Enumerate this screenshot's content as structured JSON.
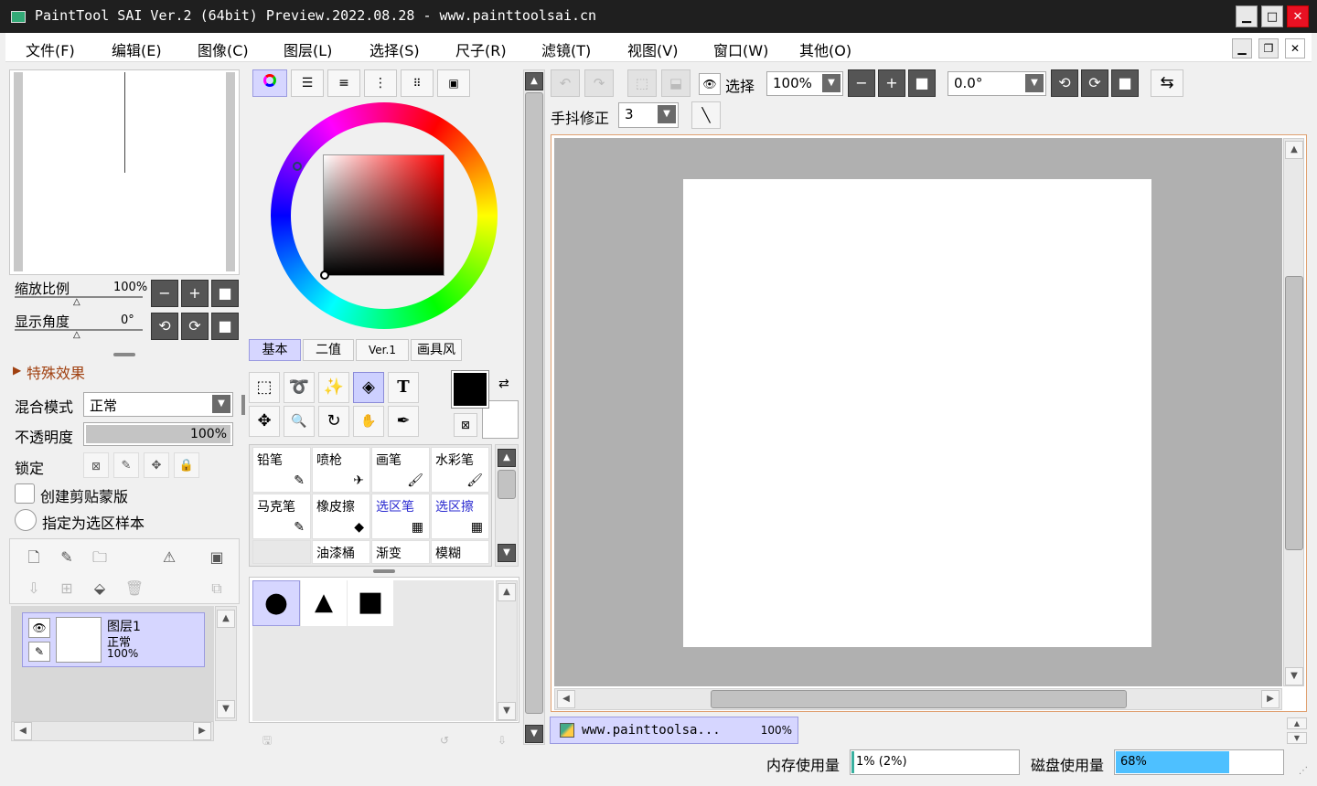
{
  "window": {
    "title": "PaintTool SAI Ver.2 (64bit) Preview.2022.08.28 - www.painttoolsai.cn",
    "minimize": "▁",
    "maximize": "□",
    "close": "✕"
  },
  "menu": [
    "文件(F)",
    "编辑(E)",
    "图像(C)",
    "图层(L)",
    "选择(S)",
    "尺子(R)",
    "滤镜(T)",
    "视图(V)",
    "窗口(W)",
    "其他(O)"
  ],
  "mdi": {
    "minimize": "▁",
    "restore": "❐",
    "close": "✕"
  },
  "navigator": {
    "zoom_label": "缩放比例",
    "zoom_value": "100%",
    "angle_label": "显示角度",
    "angle_value": "0°",
    "btn_minus": "−",
    "btn_plus": "+",
    "btn_reset": "■",
    "btn_ccw": "⟲",
    "btn_cw": "⟳",
    "btn_reset2": "■"
  },
  "effects": {
    "label": "特殊效果"
  },
  "layer_props": {
    "blend_label": "混合模式",
    "blend_value": "正常",
    "opacity_label": "不透明度",
    "opacity_value": "100%",
    "lock_label": "锁定",
    "clip_label": "创建剪贴蒙版",
    "sample_label": "指定为选区样本"
  },
  "layers": [
    {
      "name": "图层1",
      "mode": "正常",
      "opacity": "100%"
    }
  ],
  "color_tabs": [
    "基本",
    "二值",
    "Ver.1",
    "画具风"
  ],
  "tools_row1": [
    "⬚",
    "➰",
    "✨",
    "◈",
    "T"
  ],
  "tools_row2": [
    "✥",
    "🔍",
    "↻",
    "✋",
    "✒"
  ],
  "brushes": [
    {
      "name": "铅笔",
      "icon": "✎",
      "blue": false
    },
    {
      "name": "喷枪",
      "icon": "✈",
      "blue": false
    },
    {
      "name": "画笔",
      "icon": "🖌",
      "blue": false
    },
    {
      "name": "水彩笔",
      "icon": "🖌",
      "blue": false
    },
    {
      "name": "马克笔",
      "icon": "✎",
      "blue": false
    },
    {
      "name": "橡皮擦",
      "icon": "◆",
      "blue": false
    },
    {
      "name": "选区笔",
      "icon": "▦",
      "blue": true
    },
    {
      "name": "选区擦",
      "icon": "▦",
      "blue": true
    },
    {
      "name": "",
      "icon": "",
      "blue": false
    },
    {
      "name": "油漆桶",
      "icon": "",
      "blue": false
    },
    {
      "name": "渐变",
      "icon": "",
      "blue": false
    },
    {
      "name": "模糊",
      "icon": "",
      "blue": false
    }
  ],
  "shapes": [
    "●",
    "▲",
    "■"
  ],
  "toolbar": {
    "select_label": "选择",
    "zoom_value": "100%",
    "angle_value": "0.0°",
    "stabilizer_label": "手抖修正",
    "stabilizer_value": "3"
  },
  "document_tab": {
    "name": "www.painttoolsa...",
    "zoom": "100%"
  },
  "status": {
    "mem_label": "内存使用量",
    "mem_value": "1% (2%)",
    "mem_percent": 1,
    "disk_label": "磁盘使用量",
    "disk_value": "68%",
    "disk_percent": 68
  },
  "colors": {
    "accent": "#d6d6ff",
    "canvas_bg": "#b0b0b0",
    "disk_bar": "#4ec0ff"
  }
}
